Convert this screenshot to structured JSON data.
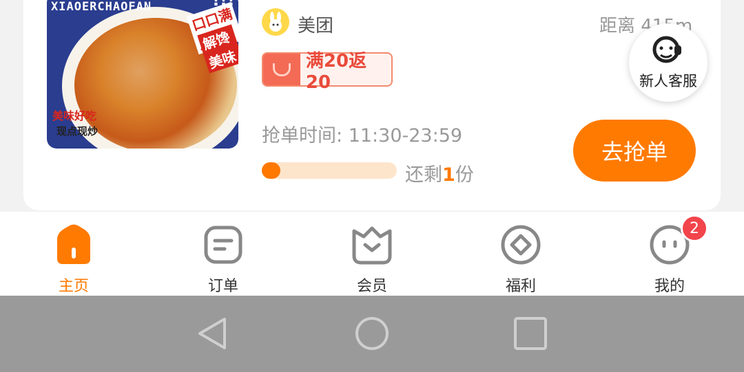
{
  "listing": {
    "image_brand": "XIAOERCHAOFAN",
    "image_tag1": "口口满足",
    "image_tag2": "解馋美味",
    "image_tag3": "美味好吃",
    "image_tag4": "现点现炒",
    "image_burst": "!!!",
    "platform": "美团",
    "distance": "距离 415m",
    "promo": "满20返20",
    "time_label": "抢单时间:",
    "time_range": "11:30-23:59",
    "remain_prefix": "还剩",
    "remain_count": "1",
    "remain_suffix": "份",
    "remain_fraction": 0.14,
    "grab_label": "去抢单"
  },
  "customer_service": {
    "label": "新人客服"
  },
  "tabbar": {
    "items": [
      {
        "label": "主页",
        "icon": "home-icon",
        "active": true
      },
      {
        "label": "订单",
        "icon": "order-icon",
        "active": false
      },
      {
        "label": "会员",
        "icon": "member-icon",
        "active": false
      },
      {
        "label": "福利",
        "icon": "welfare-icon",
        "active": false
      },
      {
        "label": "我的",
        "icon": "profile-icon",
        "active": false,
        "badge": "2"
      }
    ]
  },
  "colors": {
    "accent": "#ff7800",
    "promo_red": "#e94b3c",
    "badge_red": "#f2444b"
  }
}
